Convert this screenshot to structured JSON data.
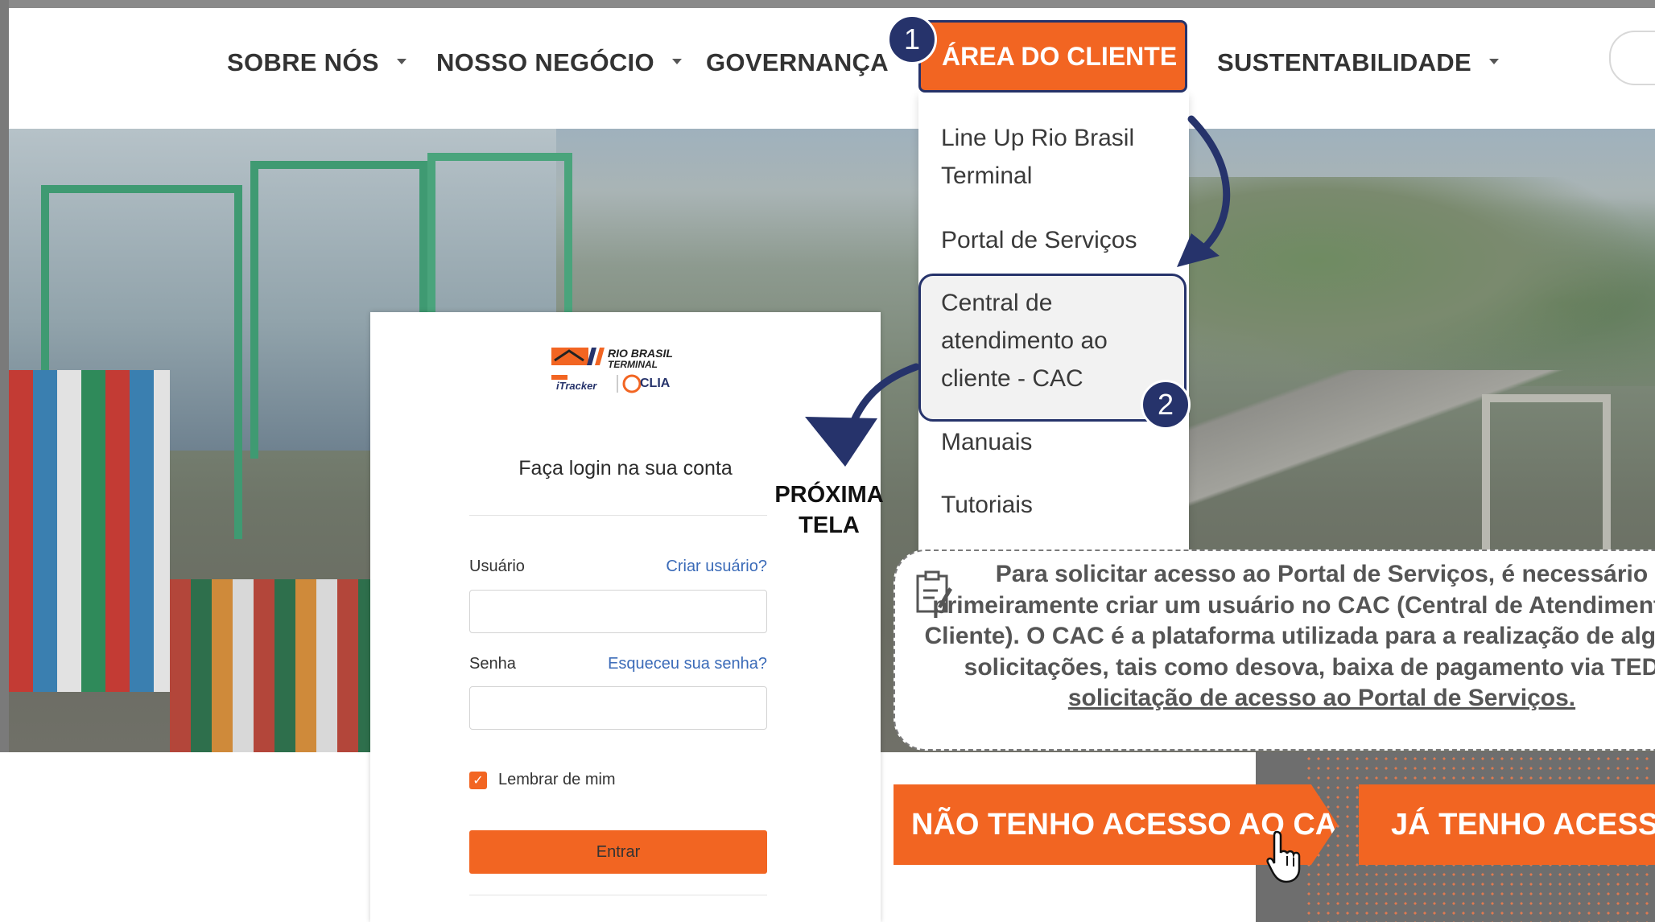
{
  "nav": {
    "items": [
      "SOBRE NÓS",
      "NOSSO NEGÓCIO",
      "GOVERNANÇA",
      "SUSTENTABILIDADE"
    ],
    "active": "ÁREA DO CLIENTE"
  },
  "dropdown": {
    "items": [
      "Line Up Rio Brasil Terminal",
      "Portal de Serviços",
      "Central de atendimento ao cliente - CAC",
      "Manuais",
      "Tutoriais"
    ]
  },
  "badges": [
    "1",
    "2"
  ],
  "login": {
    "logo": {
      "line1": "RIO BRASIL",
      "line2": "TERMINAL",
      "itracker": "iTracker",
      "clia": "CLIA"
    },
    "title": "Faça login na sua conta",
    "user_label": "Usuário",
    "create_user": "Criar usuário?",
    "password_label": "Senha",
    "forgot": "Esqueceu sua senha?",
    "remember": "Lembrar de mim",
    "submit": "Entrar"
  },
  "annotation": {
    "next_screen": "PRÓXIMA TELA",
    "note": "Para solicitar acesso ao Portal de Serviços, é necessário primeiramente criar um usuário no CAC (Central de Atendimento ao Cliente). O CAC é a plataforma utilizada para a realização de algumas solicitações, tais como desova, baixa de pagamento via TED e ",
    "note_link": "solicitação de acesso ao Portal de Serviços."
  },
  "buttons": {
    "no_access": "NÃO TENHO ACESSO AO CAC",
    "has_access": "JÁ TENHO ACESSO"
  },
  "colors": {
    "accent": "#f26522",
    "navy": "#26336b"
  }
}
